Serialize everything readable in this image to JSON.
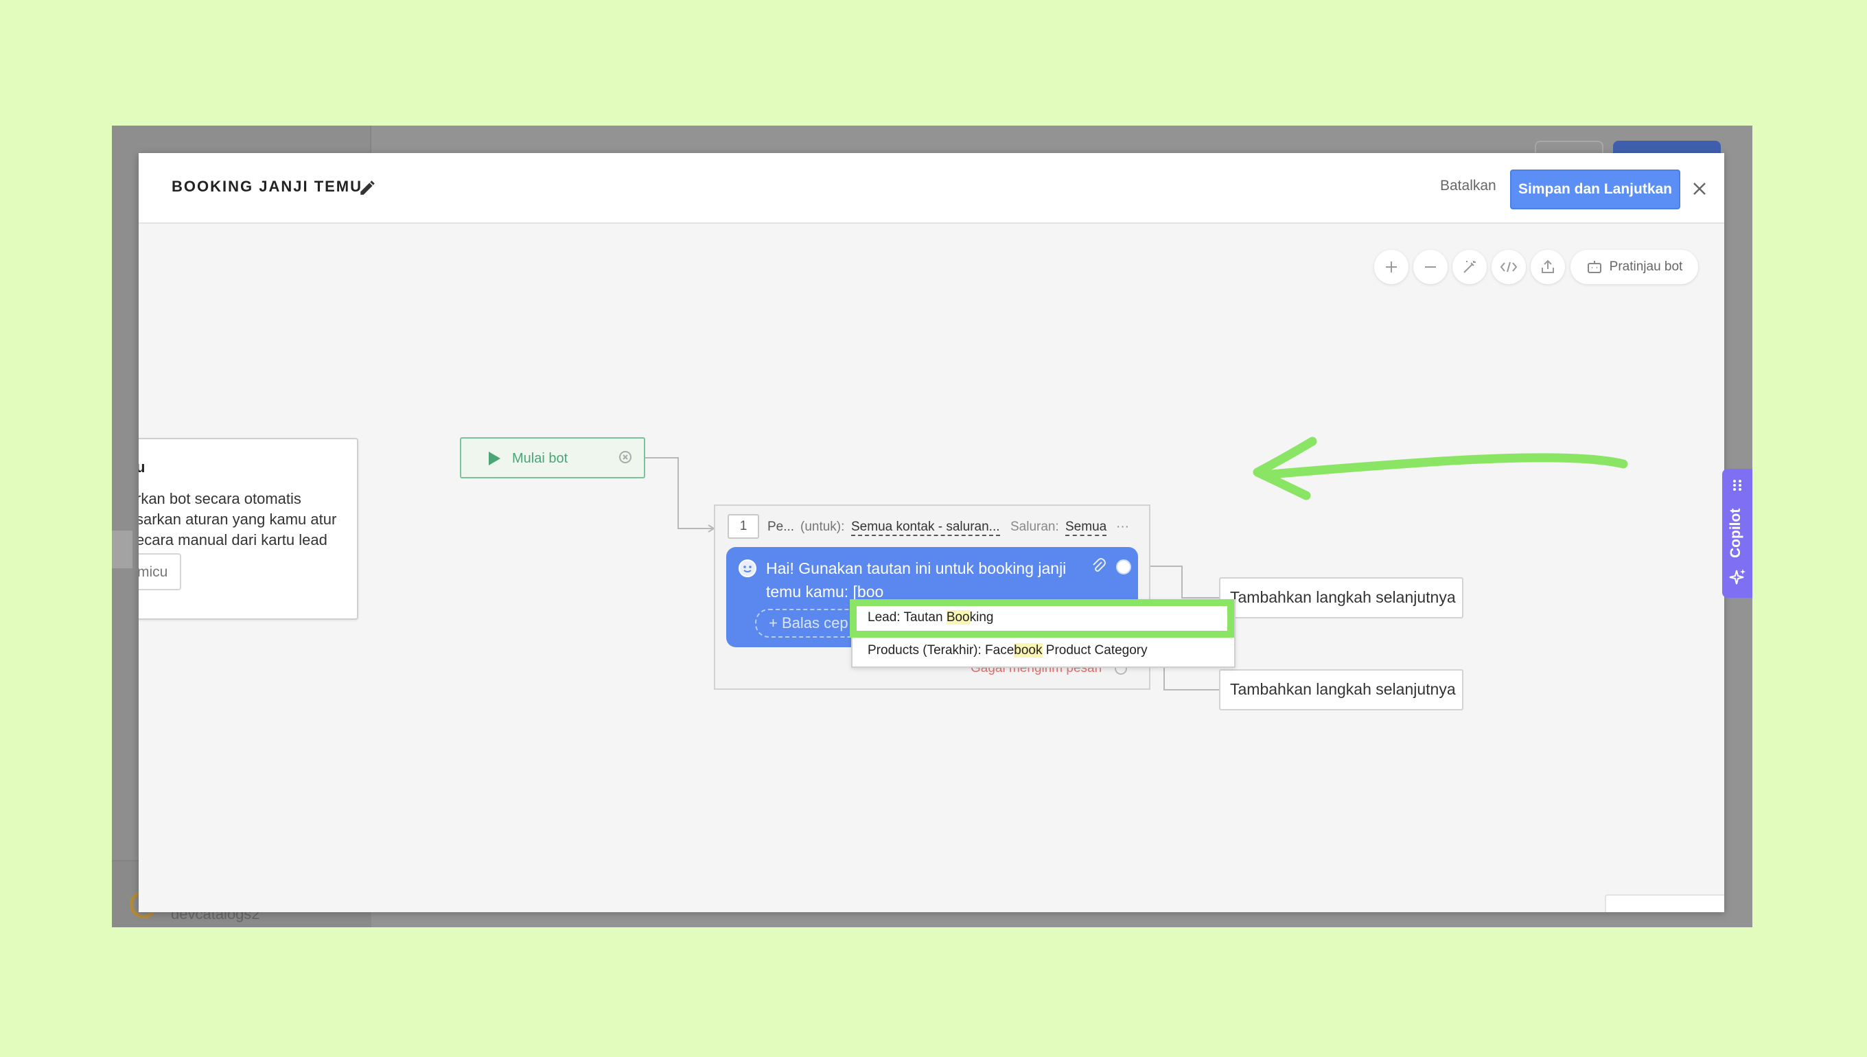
{
  "modal": {
    "title": "BOOKING JANJI TEMU",
    "cancel_label": "Batalkan",
    "save_label": "Simpan dan Lanjutkan"
  },
  "background_app": {
    "account_name": "devcatalogs2"
  },
  "toolbar": {
    "preview_label": "Pratinjau bot",
    "icons": [
      "plus-icon",
      "minus-icon",
      "magic-wand-icon",
      "code-icon",
      "export-icon",
      "bot-icon"
    ]
  },
  "trigger_card": {
    "heading": "u",
    "lines": [
      "rkan bot secara otomatis",
      "sarkan aturan yang kamu atur",
      "ecara manual dari kartu lead"
    ],
    "button_label": "micu"
  },
  "start_node": {
    "label": "Mulai bot"
  },
  "step": {
    "number": "1",
    "name": "Pe...",
    "for_label": "(untuk):",
    "for_value": "Semua kontak - saluran...",
    "channel_label": "Saluran:",
    "channel_value": "Semua",
    "more": "···",
    "message_text": "Hai! Gunakan tautan ini untuk booking janji temu kamu: [boo",
    "quick_reply_label": "+ Balas cep",
    "fail_label": "Gagal mengirim pesan"
  },
  "next_steps": {
    "first": "Tambahkan langkah selanjutnya",
    "second": "Tambahkan langkah selanjutnya"
  },
  "suggestions": {
    "item1_prefix": "Lead: Tautan ",
    "item1_match": "Boo",
    "item1_suffix": "king",
    "item2_prefix": "Products (Terakhir): Face",
    "item2_match": "book",
    "item2_suffix": " Product Category"
  },
  "copilot": {
    "label": "Copilot"
  },
  "colors": {
    "accent": "#5b8ff5",
    "highlight_green": "#8be564",
    "copilot_purple": "#7f70f3",
    "message_blue": "#5b88ee"
  }
}
